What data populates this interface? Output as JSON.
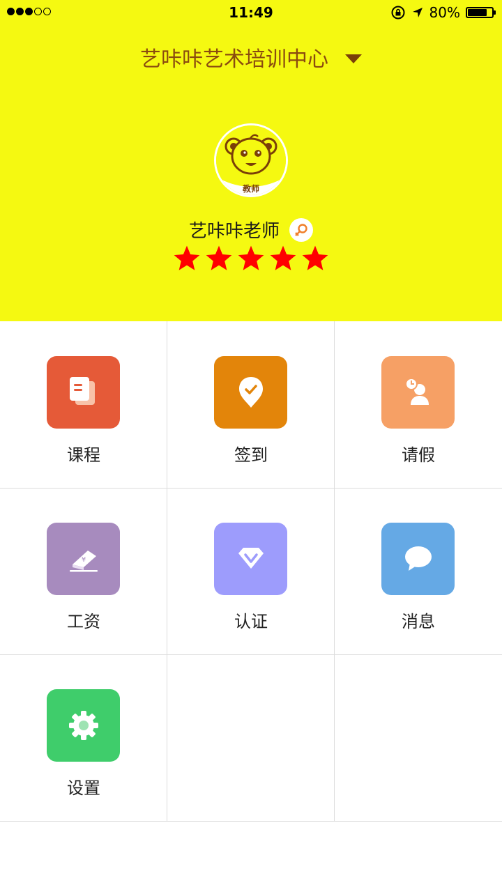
{
  "status_bar": {
    "time": "11:49",
    "battery_text": "80%",
    "battery_level": 0.8,
    "signal_bars_filled": 3,
    "signal_bars_total": 5
  },
  "header": {
    "org_name": "艺咔咔艺术培训中心",
    "bg_color": "#f5f911",
    "avatar_badge": "教师",
    "teacher_name": "艺咔咔老师",
    "gender_icon": "female-icon",
    "rating": 5,
    "rating_max": 5,
    "star_color": "#ff0000"
  },
  "menu": {
    "items": [
      {
        "label": "课程",
        "icon": "document-icon",
        "color": "#e55a38"
      },
      {
        "label": "签到",
        "icon": "checkin-pin-icon",
        "color": "#e3850a"
      },
      {
        "label": "请假",
        "icon": "leave-person-clock-icon",
        "color": "#f6a065"
      },
      {
        "label": "工资",
        "icon": "salary-eraser-icon",
        "color": "#a78bbe"
      },
      {
        "label": "认证",
        "icon": "diamond-icon",
        "color": "#9d9cfc"
      },
      {
        "label": "消息",
        "icon": "chat-bubble-icon",
        "color": "#65a9e5"
      },
      {
        "label": "设置",
        "icon": "gear-icon",
        "color": "#3fcd6b"
      }
    ]
  }
}
